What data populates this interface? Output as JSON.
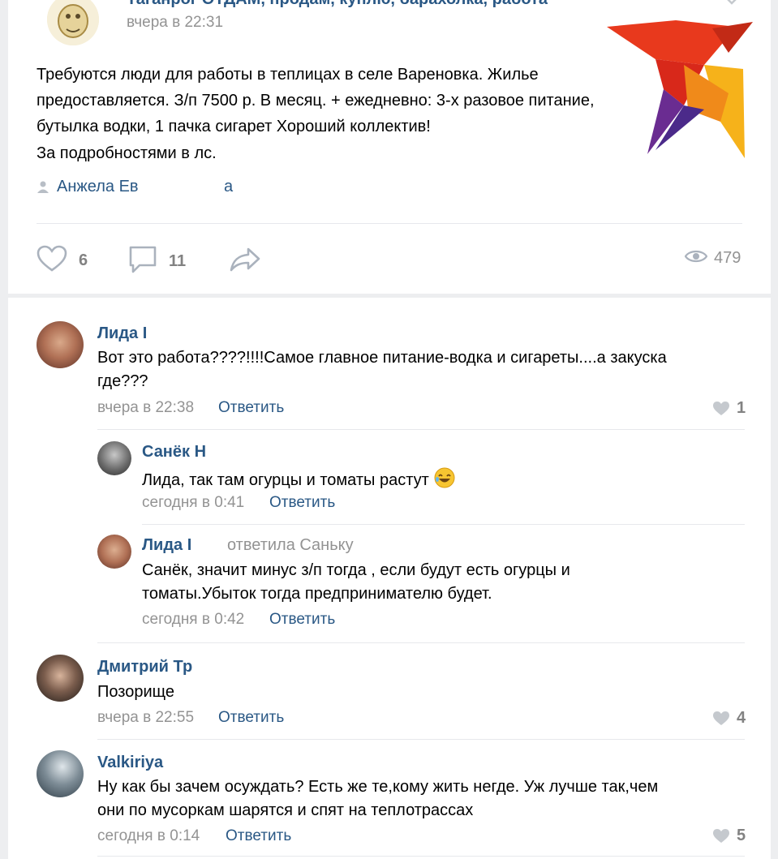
{
  "post": {
    "group_name": "Таганрог ОТДАМ, продам, куплю, барахолка, работа",
    "time": "вчера в 22:31",
    "text_lines": [
      "Требуются люди для работы в теплицах в селе Вареновка. Жилье",
      "предоставляется. З/п 7500 р. В месяц. + ежедневно: 3-х разовое питание,",
      "бутылка водки, 1 пачка сигарет Хороший коллектив!",
      "За подробностями в лс."
    ],
    "signer": "Анжела Ев",
    "signer_tail": "а",
    "likes": "6",
    "comments": "11",
    "views": "479"
  },
  "comments": [
    {
      "author": "Лида І",
      "text_lines": [
        "Вот это работа????!!!!Самое главное питание-водка и сигареты....а закуска",
        "где???"
      ],
      "time": "вчера в 22:38",
      "reply": "Ответить",
      "likes": "1"
    },
    {
      "author": "Санёк Н",
      "text_lines": [
        "Лида, так там огурцы и томаты растут"
      ],
      "time": "сегодня в 0:41",
      "reply": "Ответить"
    },
    {
      "author": "Лида І",
      "replied_to": "ответила Саньку",
      "text_lines": [
        "Санёк, значит минус з/п тогда , если будут есть огурцы и",
        "томаты.Убыток тогда предпринимателю будет."
      ],
      "time": "сегодня в 0:42",
      "reply": "Ответить"
    },
    {
      "author": "Дмитрий Тр",
      "text_lines": [
        "Позорище"
      ],
      "time": "вчера в 22:55",
      "reply": "Ответить",
      "likes": "4"
    },
    {
      "author": "Valkiriya",
      "text_lines": [
        "Ну как бы зачем осуждать? Есть же те,кому жить негде. Уж лучше так,чем",
        "они по мусоркам шарятся и спят на теплотрассах"
      ],
      "time": "сегодня в 0:14",
      "reply": "Ответить",
      "likes": "5"
    }
  ],
  "colors": {
    "link": "#2a5885",
    "meta": "#939393",
    "background": "#edeef0",
    "logo_red": "#e8391d",
    "logo_orange": "#f59a1b",
    "logo_purple": "#6a2c91"
  },
  "icons": [
    "group-avatar-icon",
    "heart-icon",
    "comment-icon",
    "share-icon",
    "eye-icon",
    "user-icon",
    "laughing-emoji-icon",
    "swallow-logo-icon"
  ]
}
